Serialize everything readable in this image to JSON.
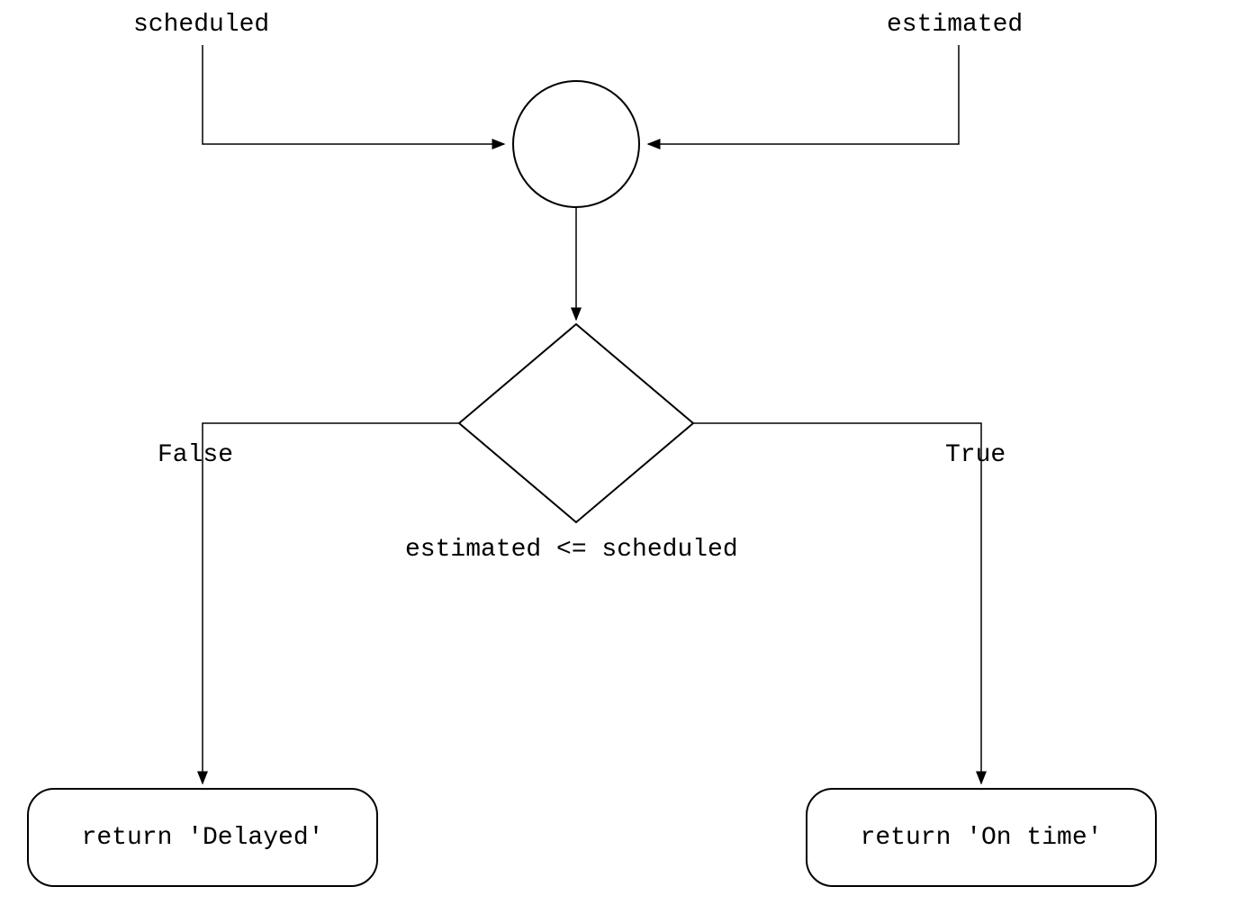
{
  "inputs": {
    "left": "scheduled",
    "right": "estimated"
  },
  "decision": {
    "condition": "estimated <= scheduled",
    "falseLabel": "False",
    "trueLabel": "True"
  },
  "outputs": {
    "false": "return 'Delayed'",
    "true": "return 'On time'"
  }
}
